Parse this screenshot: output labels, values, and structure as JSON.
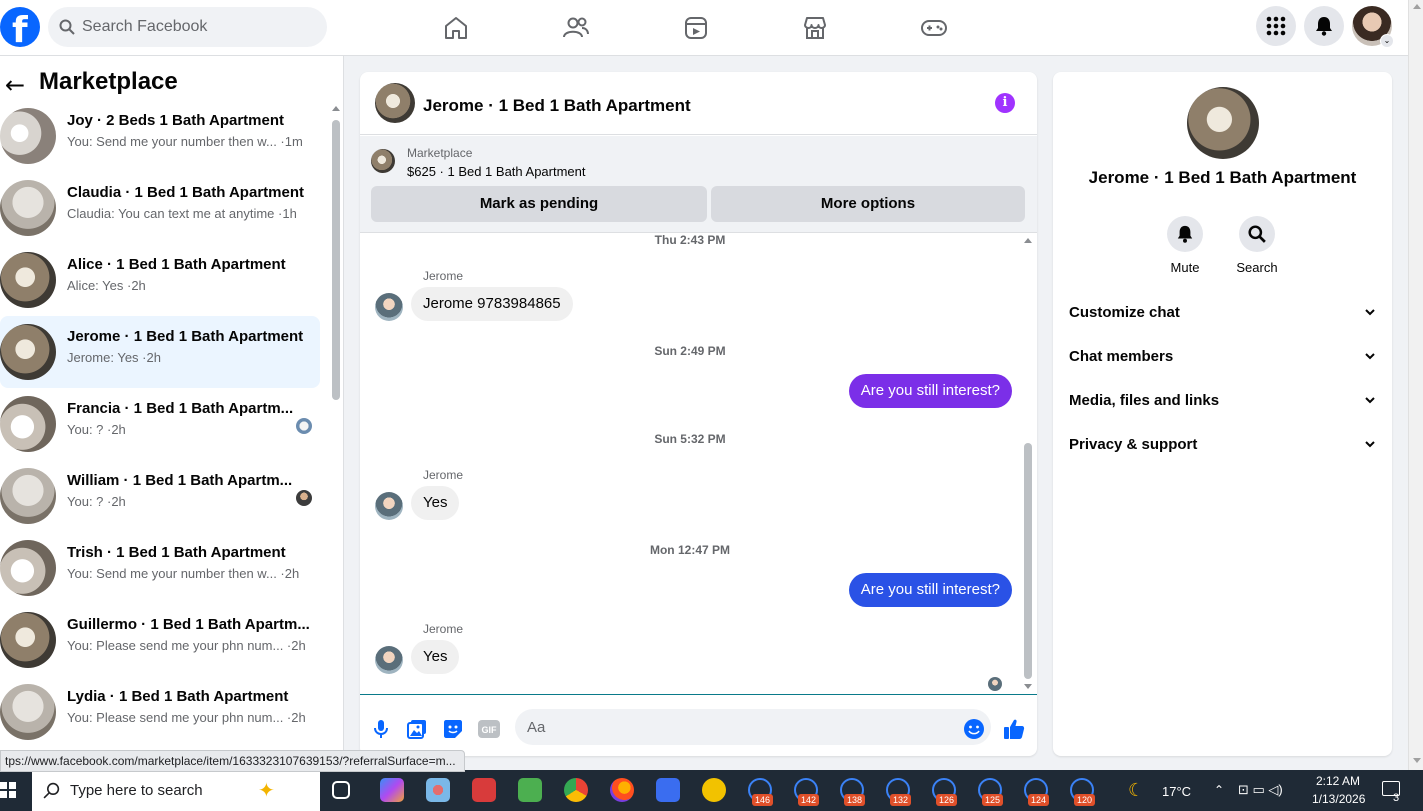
{
  "topbar": {
    "logo": "facebook-logo",
    "search_placeholder": "Search Facebook",
    "nav_icons": [
      "home-icon",
      "friends-icon",
      "video-icon",
      "marketplace-icon",
      "gaming-icon"
    ],
    "right_icons": [
      "menu-grid-icon",
      "notifications-bell-icon",
      "profile-avatar"
    ]
  },
  "sidebar": {
    "back_icon": "←",
    "title": "Marketplace",
    "conversations": [
      {
        "title": "Joy · 2 Beds 1 Bath Apartment",
        "preview": "You: Send me your number then w... ·1m"
      },
      {
        "title": "Claudia · 1 Bed 1 Bath Apartment",
        "preview": "Claudia: You can text me at anytime ·1h"
      },
      {
        "title": "Alice · 1 Bed 1 Bath Apartment",
        "preview": "Alice: Yes ·2h"
      },
      {
        "title": "Jerome · 1 Bed 1 Bath Apartment",
        "preview": "Jerome: Yes ·2h"
      },
      {
        "title": "Francia · 1 Bed 1 Bath Apartm...",
        "preview": "You: ? ·2h"
      },
      {
        "title": "William · 1 Bed 1 Bath Apartm...",
        "preview": "You: ? ·2h"
      },
      {
        "title": "Trish · 1 Bed 1 Bath Apartment",
        "preview": "You: Send me your number then w... ·2h"
      },
      {
        "title": "Guillermo · 1 Bed 1 Bath Apartm...",
        "preview": "You: Please send me your phn num... ·2h"
      },
      {
        "title": "Lydia · 1 Bed 1 Bath Apartment",
        "preview": "You: Please send me your phn num... ·2h"
      }
    ],
    "active_index": 3
  },
  "status_url": "tps://www.facebook.com/marketplace/item/1633323107639153/?referralSurface=m...",
  "chat": {
    "title": "Jerome · 1 Bed 1 Bath Apartment",
    "info_icon": "i",
    "listing": {
      "source": "Marketplace",
      "item": "$625 · 1 Bed 1 Bath Apartment",
      "pending_label": "Mark as pending",
      "more_label": "More options"
    },
    "messages": {
      "ts1": "Thu 2:43 PM",
      "sender1": "Jerome",
      "msg1": "Jerome 9783984865",
      "ts2": "Sun 2:49 PM",
      "msg2": "Are you still interest?",
      "ts3": "Sun 5:32 PM",
      "sender3": "Jerome",
      "msg3": "Yes",
      "ts4": "Mon 12:47 PM",
      "msg4": "Are you still interest?",
      "sender5": "Jerome",
      "msg5": "Yes"
    },
    "composer_placeholder": "Aa",
    "composer_icons": [
      "microphone-icon",
      "photo-icon",
      "sticker-icon",
      "gif-icon",
      "emoji-icon",
      "like-icon"
    ],
    "colors": {
      "outgoing_purple": "#7b2fe8",
      "outgoing_blue": "#2a52e6",
      "accent": "#0866ff"
    }
  },
  "details": {
    "name": "Jerome · 1 Bed 1 Bath Apartment",
    "mute_label": "Mute",
    "search_label": "Search",
    "sections": [
      "Customize chat",
      "Chat members",
      "Media, files and links",
      "Privacy & support"
    ]
  },
  "taskbar": {
    "search_placeholder": "Type here to search",
    "badges": [
      "146",
      "142",
      "138",
      "132",
      "126",
      "125",
      "124",
      "120"
    ],
    "weather": "17°C",
    "time": "2:12 AM",
    "date": "1/13/2026",
    "notifications": "3"
  }
}
